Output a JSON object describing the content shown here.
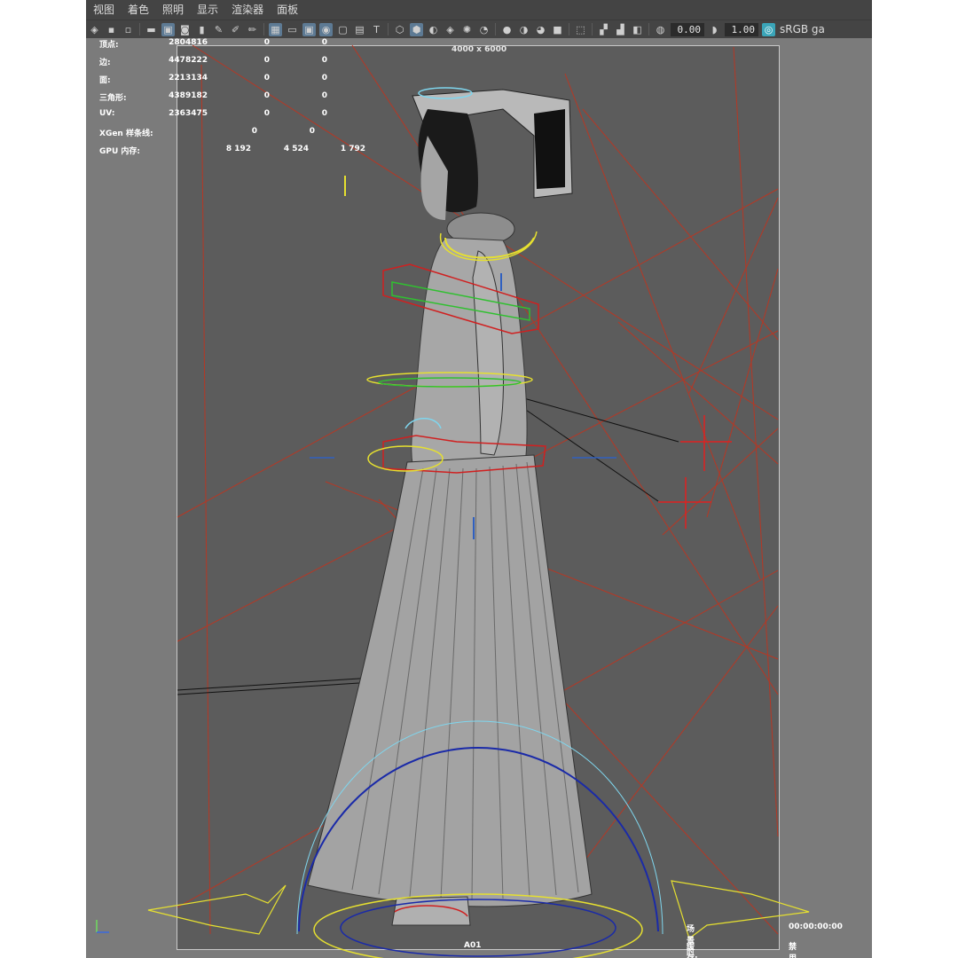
{
  "menu": [
    "视图",
    "着色",
    "照明",
    "显示",
    "渲染器",
    "面板"
  ],
  "toolbar": {
    "icons": [
      "camera-icon",
      "bookmark-icon",
      "grid-icon",
      "film-gate-icon",
      "resolution-gate-icon",
      "safe-action-icon",
      "texture-icon",
      "wireframe-cube-icon",
      "smooth-shade-icon",
      "light-icon",
      "shadow-icon",
      "xray-icon",
      "isolate-icon",
      "exposure-icon",
      "gamma-icon",
      "color-management-icon"
    ],
    "exposure_value": "0.00",
    "gamma_value": "1.00",
    "color_space_label": "sRGB ga"
  },
  "viewport": {
    "resolution_label": "4000 x 6000",
    "camera_name": "A01"
  },
  "hud": {
    "stats": [
      {
        "label": "顶点:",
        "values": [
          "2804816",
          "0",
          "0"
        ]
      },
      {
        "label": "边:",
        "values": [
          "4478222",
          "0",
          "0"
        ]
      },
      {
        "label": "面:",
        "values": [
          "2213134",
          "0",
          "0"
        ]
      },
      {
        "label": "三角形:",
        "values": [
          "4389182",
          "0",
          "0"
        ]
      },
      {
        "label": "UV:",
        "values": [
          "2363475",
          "0",
          "0"
        ]
      },
      {
        "label": "XGen 样条线:",
        "values": [
          "0",
          "0"
        ]
      },
      {
        "label": "GPU 内存:",
        "values": [
          "8 192",
          "4 524",
          "1 792"
        ]
      }
    ],
    "timecode_label": "场景时间码:",
    "timecode_value": "00:00:00:00",
    "cache_label": "缓存:",
    "cache_value": "禁用"
  },
  "colors": {
    "menu_bg": "#444444",
    "viewport_bg": "#7b7b7b",
    "gate_bg": "#5c5c5c",
    "selection_accent": "#3aa5b8",
    "rig_red": "#cc2222",
    "rig_yellow": "#e6e030",
    "rig_cyan": "#7fd6ee",
    "rig_blue": "#1a2aa8"
  }
}
